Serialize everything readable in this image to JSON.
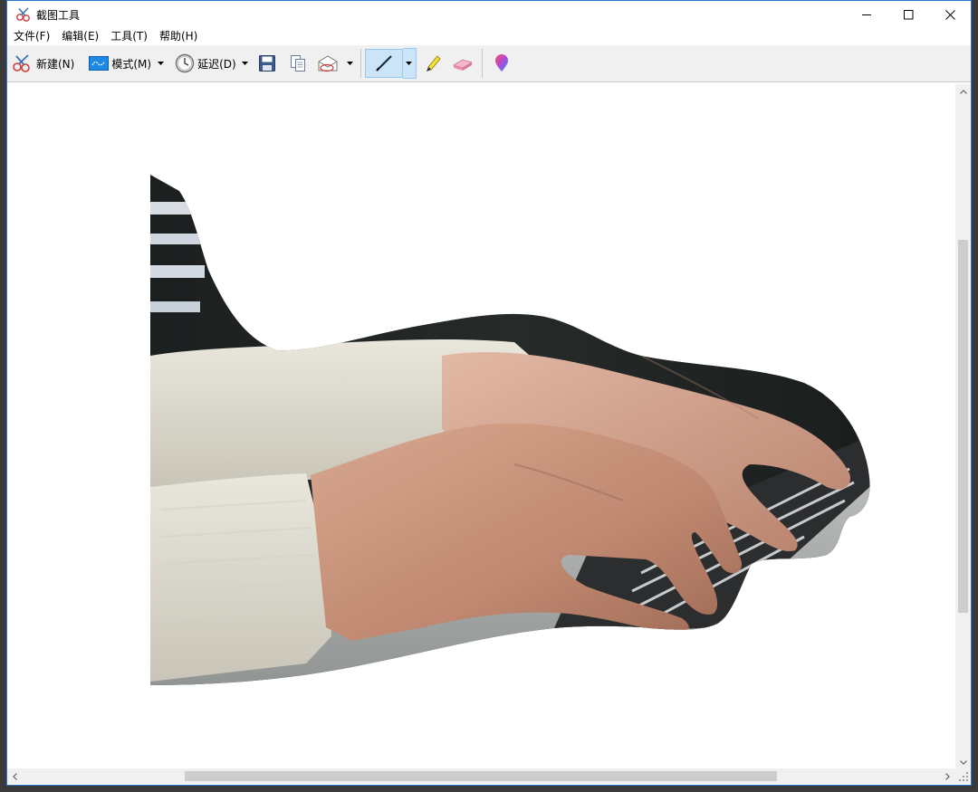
{
  "window": {
    "title": "截图工具",
    "controls": {
      "minimize": "minimize-icon",
      "maximize": "maximize-icon",
      "close": "close-icon"
    }
  },
  "menu": {
    "items": [
      {
        "label": "文件(F)"
      },
      {
        "label": "编辑(E)"
      },
      {
        "label": "工具(T)"
      },
      {
        "label": "帮助(H)"
      }
    ]
  },
  "toolbar": {
    "new_label": "新建(N)",
    "mode_label": "模式(M)",
    "delay_label": "延迟(D)",
    "icons": {
      "new": "scissors-icon",
      "mode": "mode-icon",
      "delay": "clock-icon",
      "save": "save-icon",
      "copy": "copy-icon",
      "send": "send-email-icon",
      "pen": "pen-icon",
      "highlighter": "highlighter-icon",
      "eraser": "eraser-icon",
      "paint3d": "paint3d-icon"
    }
  },
  "canvas": {
    "image": "free-form snip of hands typing on a keyboard"
  },
  "colors": {
    "accent": "#2b79d0",
    "pressed": "#cce4f7",
    "toolbar_bg": "#f0f0f0"
  }
}
